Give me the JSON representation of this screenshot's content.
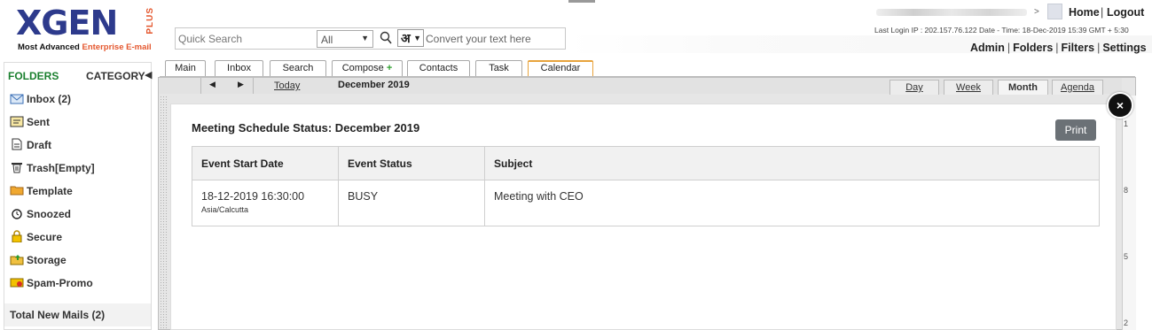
{
  "logo": {
    "word": "XGEN",
    "plus": "PLUS",
    "tagline_prefix": "Most Advanced",
    "tagline_accent": "Enterprise E-mail"
  },
  "search": {
    "placeholder": "Quick Search",
    "filter_value": "All",
    "lang_glyph": "अ",
    "convert_placeholder": "Convert your text here"
  },
  "header": {
    "caret": ">",
    "home": "Home",
    "sep": "|",
    "logout": "Logout",
    "last_login": "Last Login IP : 202.157.76.122 Date - Time: 18-Dec-2019 15:39 GMT + 5:30",
    "admin_links": [
      "Admin",
      "Folders",
      "Filters",
      "Settings"
    ]
  },
  "sidebar": {
    "folders_label": "FOLDERS",
    "category_label": "CATEGORY",
    "collapse": "◀",
    "items": [
      {
        "label": "Inbox (2)",
        "icon": "inbox-icon"
      },
      {
        "label": "Sent",
        "icon": "sent-icon"
      },
      {
        "label": "Draft",
        "icon": "draft-icon"
      },
      {
        "label": "Trash[Empty]",
        "icon": "trash-icon"
      },
      {
        "label": "Template",
        "icon": "template-icon"
      },
      {
        "label": "Snoozed",
        "icon": "alarm-icon"
      },
      {
        "label": "Secure",
        "icon": "lock-icon"
      },
      {
        "label": "Storage",
        "icon": "storage-folder-icon"
      },
      {
        "label": "Spam-Promo",
        "icon": "spam-icon"
      }
    ],
    "total_new": "Total New Mails (2)"
  },
  "tabs": [
    "Main",
    "Inbox",
    "Search",
    "Compose",
    "Contacts",
    "Task",
    "Calendar"
  ],
  "calendar": {
    "today": "Today",
    "month_title": "December 2019",
    "views": [
      "Day",
      "Week",
      "Month",
      "Agenda"
    ],
    "active_view": "Month",
    "right_numbers": [
      "1",
      "8",
      "5",
      "2"
    ]
  },
  "modal": {
    "title": "Meeting Schedule Status: December 2019",
    "print": "Print",
    "close": "×",
    "columns": [
      "Event Start Date",
      "Event Status",
      "Subject"
    ],
    "rows": [
      {
        "start": "18-12-2019 16:30:00",
        "tz": "Asia/Calcutta",
        "status": "BUSY",
        "subject": "Meeting with CEO"
      }
    ]
  }
}
